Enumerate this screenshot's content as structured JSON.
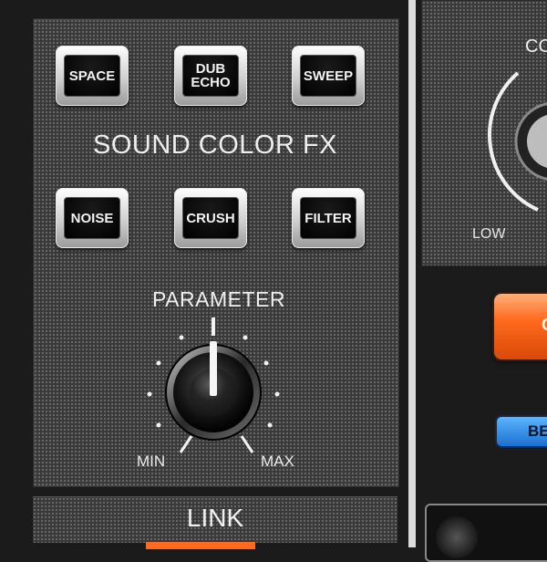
{
  "sound_color_fx": {
    "title": "SOUND COLOR FX",
    "buttons_row1": [
      {
        "label": "SPACE"
      },
      {
        "label": "DUB\nECHO"
      },
      {
        "label": "SWEEP"
      }
    ],
    "buttons_row2": [
      {
        "label": "NOISE"
      },
      {
        "label": "CRUSH"
      },
      {
        "label": "FILTER"
      }
    ]
  },
  "parameter": {
    "title": "PARAMETER",
    "min_label": "MIN",
    "max_label": "MAX",
    "level": 0.5,
    "knob_icon": "rotary-knob-icon"
  },
  "link": {
    "label": "LINK"
  },
  "right_panel": {
    "knob_label_partial": "CO",
    "low_label": "LOW",
    "orange_button_label_partial": "C",
    "blue_button_label_partial": "BE"
  },
  "colors": {
    "panel": "#3a3a3a",
    "button_face": "#000000",
    "accent_orange": "#ff6a1e",
    "accent_blue": "#1d6fd1"
  }
}
